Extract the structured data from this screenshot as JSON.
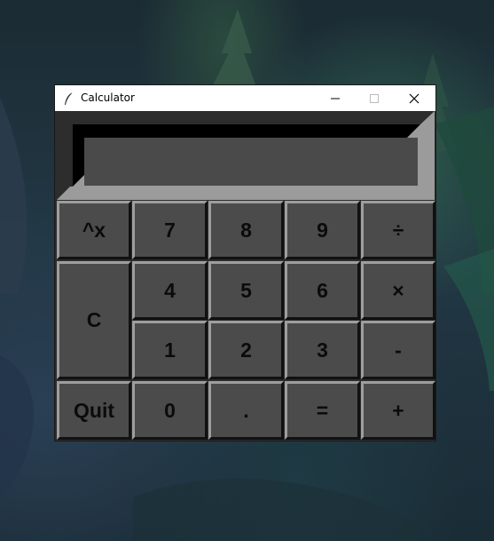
{
  "window": {
    "title": "Calculator",
    "minimize_glyph": "minimize-icon",
    "maximize_glyph": "maximize-icon",
    "close_glyph": "close-icon"
  },
  "display": {
    "value": ""
  },
  "buttons": {
    "power": "^x",
    "seven": "7",
    "eight": "8",
    "nine": "9",
    "divide": "÷",
    "clear": "C",
    "four": "4",
    "five": "5",
    "six": "6",
    "multiply": "×",
    "one": "1",
    "two": "2",
    "three": "3",
    "minus": "-",
    "quit": "Quit",
    "zero": "0",
    "dot": ".",
    "equals": "=",
    "plus": "+"
  },
  "colors": {
    "button_face": "#4b4b4b",
    "button_highlight": "#9e9e9e",
    "button_shadow": "#111111",
    "display_face": "#4a4a4a",
    "window_bg": "#2c2c2c"
  }
}
